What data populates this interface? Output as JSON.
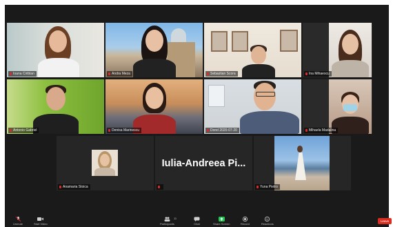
{
  "participants": [
    {
      "name": "Ioana Ciriblan"
    },
    {
      "name": "Andra Meza"
    },
    {
      "name": "Sebastian Scora"
    },
    {
      "name": "Ina Mihaescu"
    },
    {
      "name": "Antonio Gabriel"
    },
    {
      "name": "Denisa Marinescu"
    },
    {
      "name": "Dorel 2020-07-20"
    },
    {
      "name": "Mihaela Madalina"
    },
    {
      "name": "Anamaria Stoica"
    },
    {
      "name": ""
    },
    {
      "name": "Yuna Pietro"
    }
  ],
  "camera_off_name": "Iulia-Andreea  Pi...",
  "toolbar": {
    "unmute": "Unmute",
    "start_video": "Start Video",
    "participants": "Participants",
    "participants_count": "11",
    "chat": "Chat",
    "share_screen": "Share Screen",
    "record": "Record",
    "reactions": "Reactions",
    "leave": "Leave"
  },
  "colors": {
    "background": "#1a1a1a",
    "active_speaker_border": "#7ed321",
    "muted_icon": "#e02828",
    "share_screen": "#23c552",
    "leave": "#d92d20"
  }
}
